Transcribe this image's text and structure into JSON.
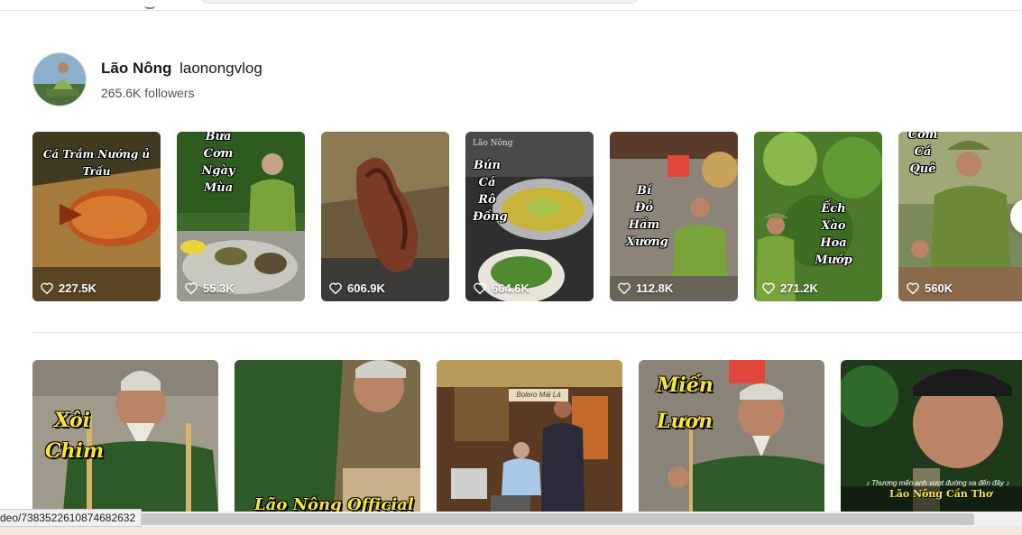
{
  "creator": {
    "name": "Lão Nông",
    "handle": "laonongvlog",
    "followers": "265.6K followers"
  },
  "row1_videos": [
    {
      "caption": "Cá Trắm Nướng ủ Trấu",
      "likes": "227.5K"
    },
    {
      "caption": "Bữa Cơm Ngày Mùa",
      "likes": "55.3K"
    },
    {
      "caption": "",
      "likes": "606.9K"
    },
    {
      "caption": "Bún Cá Rô Đồng",
      "likes": "664.6K",
      "watermark": "Lão Nông"
    },
    {
      "caption": "Bí Đỏ Hầm Xương",
      "likes": "112.8K"
    },
    {
      "caption": "Ếch Xào Hoa Mướp",
      "likes": "271.2K"
    },
    {
      "caption": "Cơm Cá Quê",
      "likes": "560K"
    }
  ],
  "row2_videos": [
    {
      "title": "Xôi Chim"
    },
    {
      "title": "Lão Nông Official"
    },
    {
      "sign": "Bolero Mái Lá"
    },
    {
      "title": "Miến Lươn"
    },
    {
      "subtitle": "♪ Thương mến anh vượt đường xa đến đây ♪",
      "channel": "Lão Nông Cần Thơ"
    }
  ],
  "status_bar": {
    "url": "deo/7383522610874682632"
  },
  "icons": {
    "like": "heart-outline-icon",
    "next": "chevron-right-icon"
  }
}
